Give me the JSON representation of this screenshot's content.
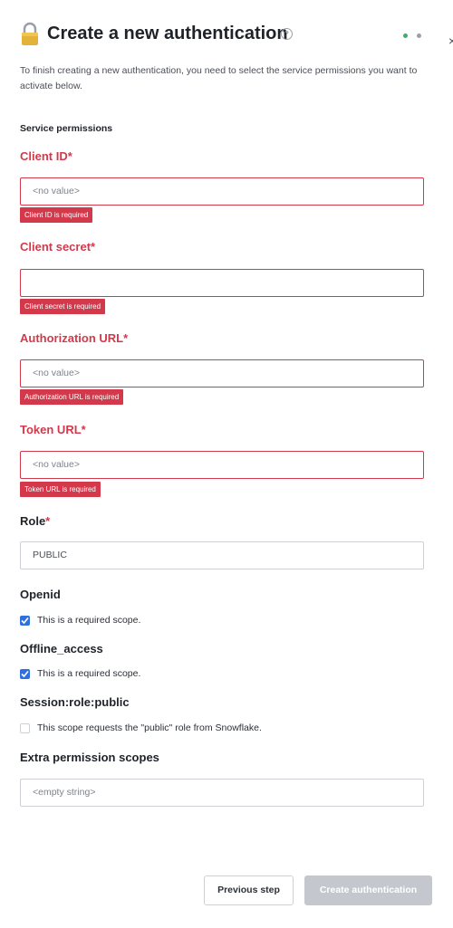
{
  "header": {
    "title": "Create a new authentication",
    "close_glyph": "×",
    "help_glyph": "?",
    "lock_icon": "lock-icon"
  },
  "description": "To finish creating a new authentication, you need to select the service permissions you want to activate below.",
  "section_title": "Service permissions",
  "fields": {
    "client_id": {
      "label": "Client ID",
      "required_mark": "*",
      "value": "<no value>",
      "error": "Client ID is required"
    },
    "client_secret": {
      "label": "Client secret",
      "required_mark": "*",
      "value": "",
      "error": "Client secret is required"
    },
    "authorization_url": {
      "label": "Authorization URL",
      "required_mark": "*",
      "value": "<no value>",
      "error": "Authorization URL is required"
    },
    "token_url": {
      "label": "Token URL",
      "required_mark": "*",
      "value": "<no value>",
      "error": "Token URL is required"
    },
    "role": {
      "label": "Role",
      "required_mark": "*",
      "value": "PUBLIC"
    }
  },
  "scopes": {
    "openid": {
      "label": "Openid",
      "checkbox_text": "This is a required scope.",
      "checked": true
    },
    "offline_access": {
      "label": "Offline_access",
      "checkbox_text": "This is a required scope.",
      "checked": true
    },
    "session_role_public": {
      "label": "Session:role:public",
      "checkbox_text": "This scope requests the \"public\" role from Snowflake.",
      "checked": false
    }
  },
  "extra_scopes": {
    "label": "Extra permission scopes",
    "value": "<empty string>"
  },
  "buttons": {
    "previous": "Previous step",
    "create": "Create authentication"
  },
  "colors": {
    "error": "#d4394b",
    "checkbox": "#2f6fde",
    "status_dot": "#3fae6a",
    "disabled_button": "#c4c8ce"
  }
}
